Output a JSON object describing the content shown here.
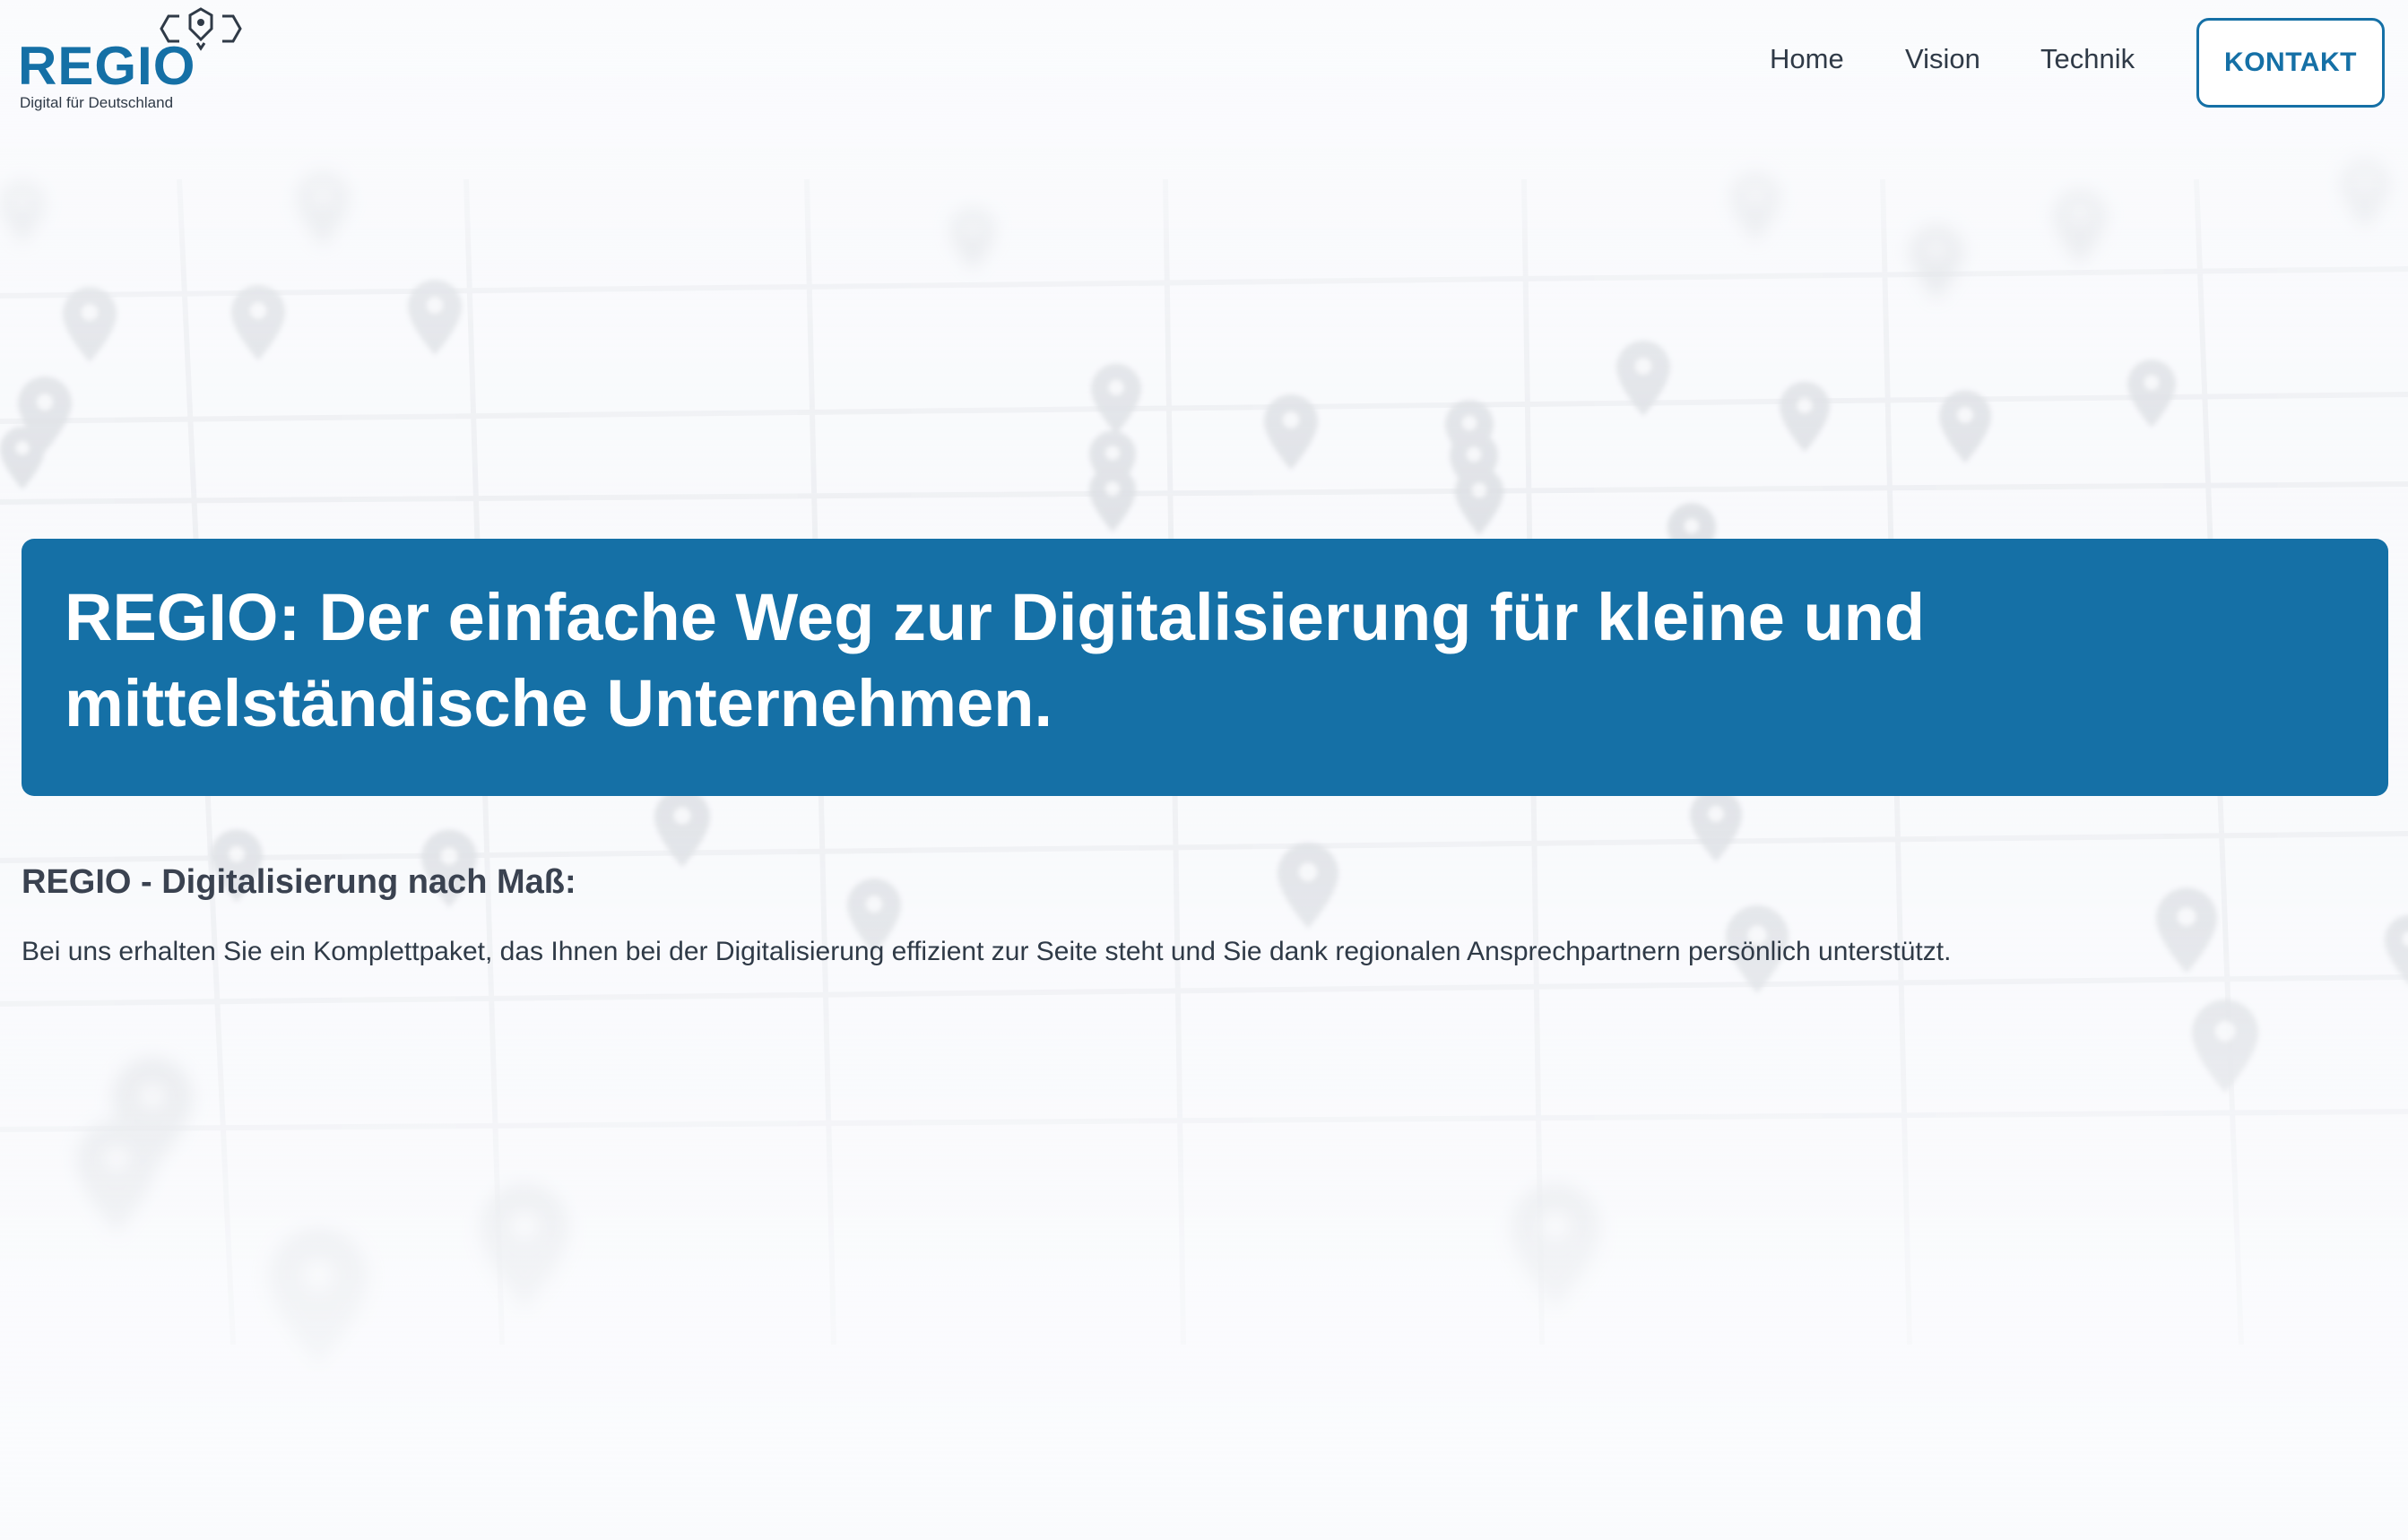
{
  "logo": {
    "wordmark": "REGIO",
    "tagline": "Digital für Deutschland"
  },
  "nav": {
    "items": [
      {
        "label": "Home"
      },
      {
        "label": "Vision"
      },
      {
        "label": "Technik"
      }
    ],
    "cta_label": "KONTAKT"
  },
  "hero": {
    "title": "REGIO: Der einfache Weg zur Digitalisierung für kleine und mittelständische Unternehmen."
  },
  "intro": {
    "heading": "REGIO - Digitalisierung nach Maß:",
    "text": "Bei uns erhalten Sie ein Komplettpaket, das Ihnen bei der Digitalisierung effizient zur Seite steht und Sie dank regionalen Ansprechpartnern persönlich unterstützt."
  },
  "colors": {
    "brand": "#1570a6",
    "text": "#2f3a47",
    "background": "#f8f9fc"
  },
  "icons": {
    "logo": "location-pin-hexagon-icon",
    "background": "map-pin-icon"
  }
}
